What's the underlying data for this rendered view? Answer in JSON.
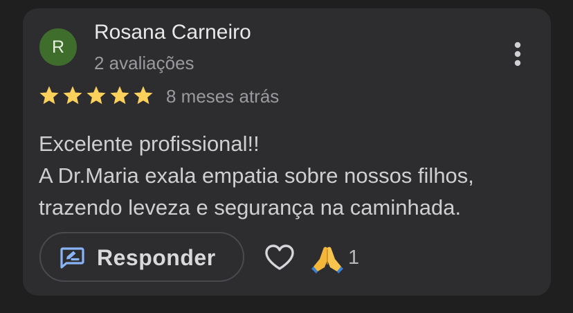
{
  "review": {
    "avatar_initial": "R",
    "author_name": "Rosana Carneiro",
    "author_reviews": "2 avaliações",
    "rating": 5,
    "rating_max": 5,
    "time_ago": "8 meses atrás",
    "text_lines": [
      "Excelente profissional!!",
      "A Dr.Maria exala empatia sobre nossos filhos,",
      "trazendo leveza e segurança na caminhada."
    ]
  },
  "actions": {
    "reply_label": "Responder",
    "reaction_count": "1"
  },
  "icons": {
    "menu": "more-vert-icon",
    "reply": "reply-edit-icon",
    "like": "heart-outline-icon",
    "reaction": "folded-hands-emoji"
  },
  "colors": {
    "background": "#1f1f1f",
    "card": "#2d2d2f",
    "avatar": "#3f6d2c",
    "star": "#fbd15b",
    "accent_blue": "#8ab4f8"
  }
}
